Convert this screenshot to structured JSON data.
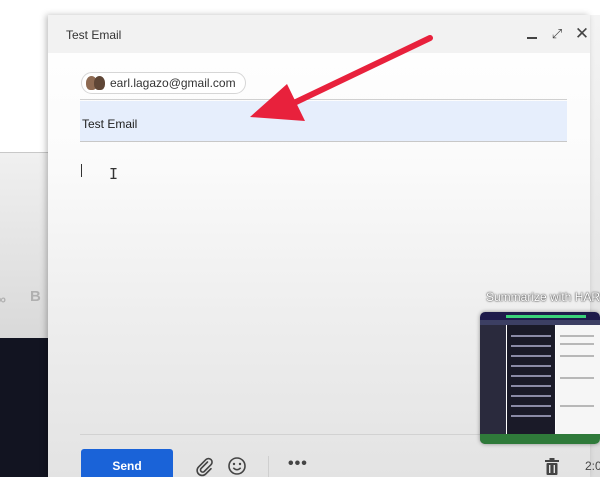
{
  "compose": {
    "title": "Test Email",
    "window_controls": {
      "minimize_icon": "minimize-icon",
      "expand_icon": "expand-icon",
      "close_icon": "close-icon",
      "close_glyph": "✕",
      "expand_glyph": "⤢"
    },
    "recipient_email": "earl.lagazo@gmail.com",
    "subject": "Test Email",
    "body_text": "",
    "send_label": "Send",
    "more_glyph": "•••"
  },
  "background": {
    "bold_glyph": "B",
    "link_glyph": "∞"
  },
  "overlay": {
    "harpa_text": "Summarize with HARP",
    "clock_text": "2:0"
  },
  "colors": {
    "send_button": "#1a63d8",
    "subject_highlight": "#e6eefc",
    "annotation_arrow": "#e8213c"
  }
}
